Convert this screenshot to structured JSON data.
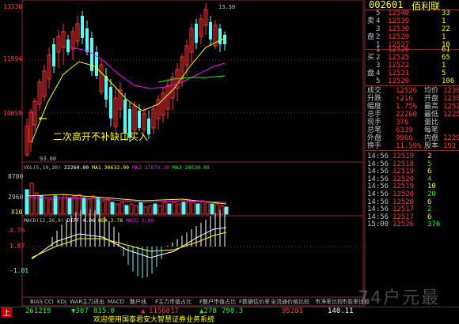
{
  "stock": {
    "code": "002601",
    "name": "佰利联"
  },
  "price_axis": {
    "labels": [
      "13330",
      "11994",
      "10659"
    ]
  },
  "chart_marks": {
    "high": "13.30",
    "low": "93.00"
  },
  "annotation": "二次高开不补缺口买入",
  "vol_panel": {
    "header": [
      {
        "text": "VOL(5,10,20)",
        "color": "#c0c0c0"
      },
      {
        "text": "22260.00",
        "color": "#ffffff"
      },
      {
        "text": "MA1 30632.00",
        "color": "#ffff00"
      },
      {
        "text": "MA2 27879.20",
        "color": "#ff00ff"
      },
      {
        "text": "MA3 29539.80",
        "color": "#00ff00"
      }
    ],
    "labels": [
      "8780",
      "2960",
      "X10"
    ]
  },
  "macd_panel": {
    "header": [
      {
        "text": "MACD(12,26,9)",
        "color": "#c0c0c0"
      },
      {
        "text": "DIFF 4.06",
        "color": "#ffffff"
      },
      {
        "text": "DEA 2.76",
        "color": "#ffff00"
      },
      {
        "text": "MACD 2.60",
        "color": "#ff00ff"
      }
    ],
    "labels": [
      "4.76",
      "1.87",
      "-1.01"
    ]
  },
  "indicator_tabs": [
    "BIAS",
    "CCI",
    "KDJ",
    "WAR",
    "主力进出",
    "MACD",
    "散户线",
    "F主力市值占比",
    "F散户市值占比",
    "F数据估价率",
    "全流通价格比较",
    "市净率比较",
    "市盈率比较"
  ],
  "order_book": {
    "sell": [
      {
        "side": "",
        "level": "5",
        "price": "12540",
        "vol": "33"
      },
      {
        "side": "卖",
        "level": "4",
        "price": "12539",
        "vol": "1"
      },
      {
        "side": "",
        "level": "3",
        "price": "12530",
        "vol": "22"
      },
      {
        "side": "盘",
        "level": "2",
        "price": "12529",
        "vol": "1"
      },
      {
        "side": "",
        "level": "1",
        "price": "12527",
        "vol": "10"
      }
    ],
    "buy": [
      {
        "side": "",
        "level": "1",
        "price": "12526",
        "vol": "61"
      },
      {
        "side": "买",
        "level": "2",
        "price": "12525",
        "vol": "65"
      },
      {
        "side": "",
        "level": "3",
        "price": "12522",
        "vol": "1"
      },
      {
        "side": "盘",
        "level": "4",
        "price": "12521",
        "vol": "5"
      },
      {
        "side": "",
        "level": "5",
        "price": "12520",
        "vol": "106"
      }
    ]
  },
  "stats": [
    {
      "label": "成交",
      "value": "12526",
      "label2": "均价",
      "value2": "1236"
    },
    {
      "label": "升跌",
      "value": "↑216",
      "label2": "开盘",
      "value2": "1238"
    },
    {
      "label": "幅度",
      "value": "1.75%",
      "label2": "最高",
      "value2": "1252"
    },
    {
      "label": "总手",
      "value": "22260",
      "label2": "最低",
      "value2": "1225"
    },
    {
      "label": "现手",
      "value": "376",
      "label2": "量比",
      "value2": ""
    },
    {
      "label": "总笔",
      "value": "6339",
      "label2": "每笔",
      "value2": ""
    },
    {
      "label": "外盘",
      "value": "9966",
      "label2": "内盘",
      "value2": "1229"
    },
    {
      "label": "换手",
      "value": "11.59%",
      "label2": "股本",
      "value2": "192"
    }
  ],
  "ticks": [
    {
      "time": "14:56",
      "price": "12519",
      "vol": "2"
    },
    {
      "time": "14:56",
      "price": "12518",
      "vol": "5"
    },
    {
      "time": "14:56",
      "price": "12519",
      "vol": "6"
    },
    {
      "time": "14:56",
      "price": "12520",
      "vol": "4"
    },
    {
      "time": "14:56",
      "price": "12519",
      "vol": "10"
    },
    {
      "time": "14:56",
      "price": "12520",
      "vol": "20"
    },
    {
      "time": "14:56",
      "price": "12520",
      "vol": "6"
    },
    {
      "time": "14:56",
      "price": "12517",
      "vol": "2"
    },
    {
      "time": "14:56",
      "price": "12517",
      "vol": "6"
    },
    {
      "time": "15:00",
      "price": "12526",
      "vol": "376"
    }
  ],
  "bottom_bar": {
    "up_label": "上",
    "index1": "261219",
    "arrow1": "▼307",
    "value1": "815.0",
    "arrow2": "▲",
    "value2": "1156817",
    "arrow3": "▲278",
    "value3": "790.3",
    "value4": "95281",
    "value5": "140.11",
    "marquee": "欢迎使用国泰君安大智慧证券业务系统",
    "watermark": "74户元最"
  },
  "colors": {
    "up": "#ff3232",
    "down": "#54fcfc",
    "yellow": "#ffff00",
    "magenta": "#ff00ff",
    "green": "#00ff00"
  }
}
